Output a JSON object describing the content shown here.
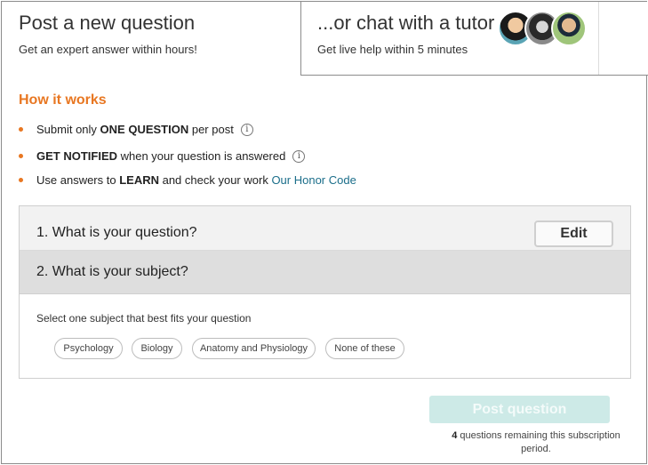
{
  "tabs": {
    "post": {
      "title": "Post a new question",
      "subtitle": "Get an expert answer within hours!"
    },
    "chat": {
      "title": "...or chat with a tutor",
      "subtitle": "Get live help within 5 minutes",
      "avatars": [
        "tutor-avatar-1",
        "tutor-avatar-2",
        "tutor-avatar-3"
      ]
    }
  },
  "how_it_works": {
    "title": "How it works",
    "bullets": [
      {
        "prefix": "Submit only ",
        "bold": "ONE QUESTION",
        "suffix": " per post",
        "info_icon": "info-icon"
      },
      {
        "prefix": "",
        "bold": "GET NOTIFIED",
        "suffix": " when your question is answered",
        "info_icon": "info-icon"
      },
      {
        "prefix": "Use answers to ",
        "bold": "LEARN",
        "suffix": " and check your work ",
        "link": "Our Honor Code"
      }
    ]
  },
  "question_steps": {
    "step1": {
      "title": "1. What is your question?",
      "edit_label": "Edit"
    },
    "step2": {
      "title": "2. What is your subject?"
    },
    "select_prompt": "Select one subject that best fits your question",
    "subjects": [
      "Psychology",
      "Biology",
      "Anatomy and Physiology",
      "None of these"
    ]
  },
  "post_button": {
    "label": "Post question"
  },
  "remaining": {
    "count": "4",
    "text": " questions remaining this subscription period."
  },
  "colors": {
    "accent_orange": "#e87722",
    "link_teal": "#1b6e8a",
    "post_button_disabled": "#cdeae7"
  }
}
